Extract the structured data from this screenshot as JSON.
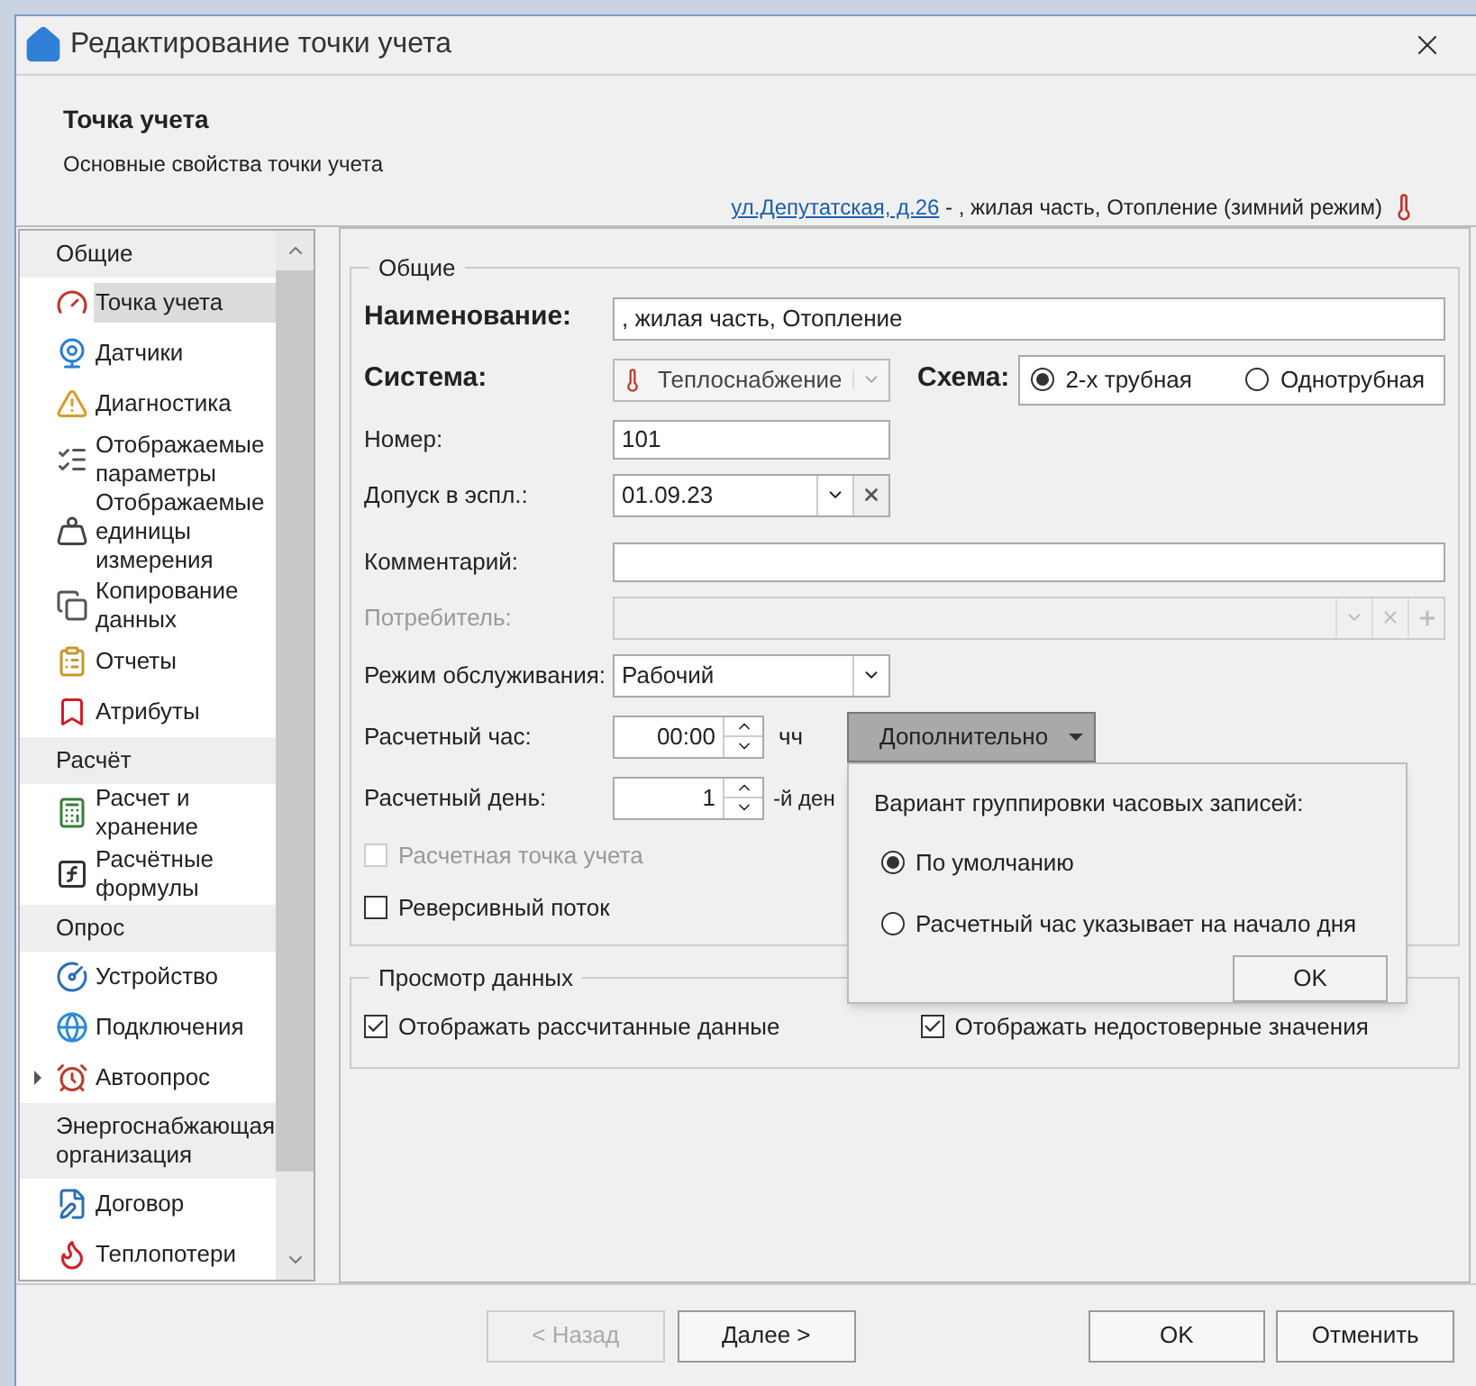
{
  "window": {
    "title": "Редактирование точки учета"
  },
  "header": {
    "title": "Точка учета",
    "subtitle": "Основные свойства точки учета",
    "link": "ул.Депутатская, д.26",
    "suffix": " - , жилая часть, Отопление (зимний режим)"
  },
  "sidebar": {
    "groups": [
      {
        "label": "Общие",
        "items": [
          {
            "label": "Точка учета",
            "selected": true,
            "expandable": false
          },
          {
            "label": "Датчики",
            "selected": false,
            "expandable": false
          },
          {
            "label": "Диагностика",
            "selected": false,
            "expandable": false
          },
          {
            "label": "Отображаемые параметры",
            "selected": false,
            "expandable": false
          },
          {
            "label": "Отображаемые единицы измерения",
            "selected": false,
            "expandable": false
          },
          {
            "label": "Копирование данных",
            "selected": false,
            "expandable": false
          },
          {
            "label": "Отчеты",
            "selected": false,
            "expandable": false
          },
          {
            "label": "Атрибуты",
            "selected": false,
            "expandable": false
          }
        ]
      },
      {
        "label": "Расчёт",
        "items": [
          {
            "label": "Расчет и хранение",
            "selected": false,
            "expandable": false
          },
          {
            "label": "Расчётные формулы",
            "selected": false,
            "expandable": false
          }
        ]
      },
      {
        "label": "Опрос",
        "items": [
          {
            "label": "Устройство",
            "selected": false,
            "expandable": false
          },
          {
            "label": "Подключения",
            "selected": false,
            "expandable": false
          },
          {
            "label": "Автоопрос",
            "selected": false,
            "expandable": true
          }
        ]
      },
      {
        "label": "Энергоснабжающая организация",
        "items": [
          {
            "label": "Договор",
            "selected": false,
            "expandable": false
          },
          {
            "label": "Теплопотери",
            "selected": false,
            "expandable": false
          }
        ]
      }
    ]
  },
  "general": {
    "legend": "Общие",
    "name": {
      "label": "Наименование:",
      "value": ", жилая часть, Отопление"
    },
    "system": {
      "label": "Система:",
      "value": "Теплоснабжение"
    },
    "scheme": {
      "label": "Схема:",
      "options": [
        {
          "label": "2-х трубная",
          "selected": true
        },
        {
          "label": "Однотрубная",
          "selected": false
        }
      ]
    },
    "number": {
      "label": "Номер:",
      "value": "101"
    },
    "commissioning": {
      "label": "Допуск в эспл.:",
      "value": "01.09.23"
    },
    "comment": {
      "label": "Комментарий:"
    },
    "consumer": {
      "label": "Потребитель:",
      "disabled": true
    },
    "service_mode": {
      "label": "Режим обслуживания:",
      "value": "Рабочий"
    },
    "calc_hour": {
      "label": "Расчетный час:",
      "value": "00:00",
      "unit": "чч"
    },
    "calc_day": {
      "label": "Расчетный день:",
      "value": "1",
      "unit": "-й ден"
    },
    "checkboxes": [
      {
        "label": "Расчетная точка учета",
        "checked": false,
        "disabled": true
      },
      {
        "label": "Реверсивный поток",
        "checked": false,
        "disabled": false
      }
    ],
    "more_button": {
      "label": "Дополнительно",
      "expanded": true
    }
  },
  "popup": {
    "title": "Вариант группировки часовых записей:",
    "options": [
      {
        "label": "По умолчанию",
        "selected": true
      },
      {
        "label": "Расчетный час указывает на начало дня",
        "selected": false
      }
    ],
    "ok": "OK"
  },
  "data_view": {
    "legend": "Просмотр данных",
    "checkboxes": [
      {
        "label": "Отображать рассчитанные данные",
        "checked": true
      },
      {
        "label": "Отображать недостоверные значения",
        "checked": true
      }
    ]
  },
  "footer": {
    "buttons": [
      {
        "label": "< Назад",
        "disabled": true
      },
      {
        "label": "Далее >",
        "disabled": false
      },
      {
        "label": "OK",
        "disabled": false
      },
      {
        "label": "Отменить",
        "disabled": false
      }
    ]
  }
}
